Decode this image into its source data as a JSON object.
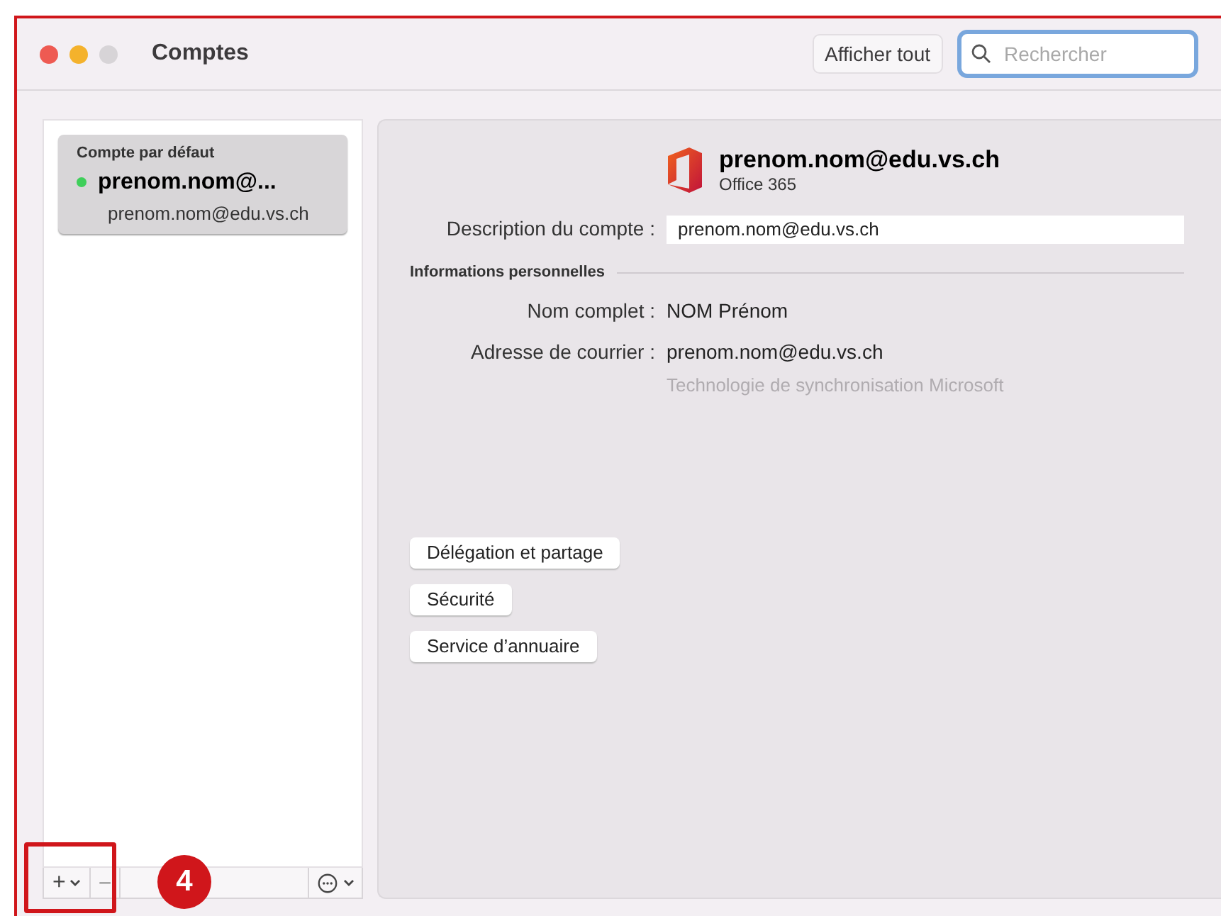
{
  "window": {
    "title": "Comptes"
  },
  "toolbar": {
    "show_all": "Afficher tout",
    "search": {
      "placeholder": "Rechercher"
    }
  },
  "accounts": [
    {
      "heading": "Compte par défaut",
      "name": "prenom.nom@...",
      "email": "prenom.nom@edu.vs.ch",
      "selected": true
    }
  ],
  "sidebar_footer": {
    "add": "+",
    "remove": "−"
  },
  "detail": {
    "title": "prenom.nom@edu.vs.ch",
    "subtitle": "Office 365",
    "description_label": "Description du compte :",
    "description_value": "prenom.nom@edu.vs.ch",
    "section": "Informations personnelles",
    "fields": [
      {
        "label": "Nom complet :",
        "value": "NOM Prénom"
      },
      {
        "label": "Adresse de courrier :",
        "value": "prenom.nom@edu.vs.ch",
        "note": "Technologie de synchronisation Microsoft"
      }
    ],
    "buttons": [
      "Délégation et partage",
      "Sécurité",
      "Service d’annuaire"
    ]
  },
  "annotation": {
    "step": "4"
  }
}
